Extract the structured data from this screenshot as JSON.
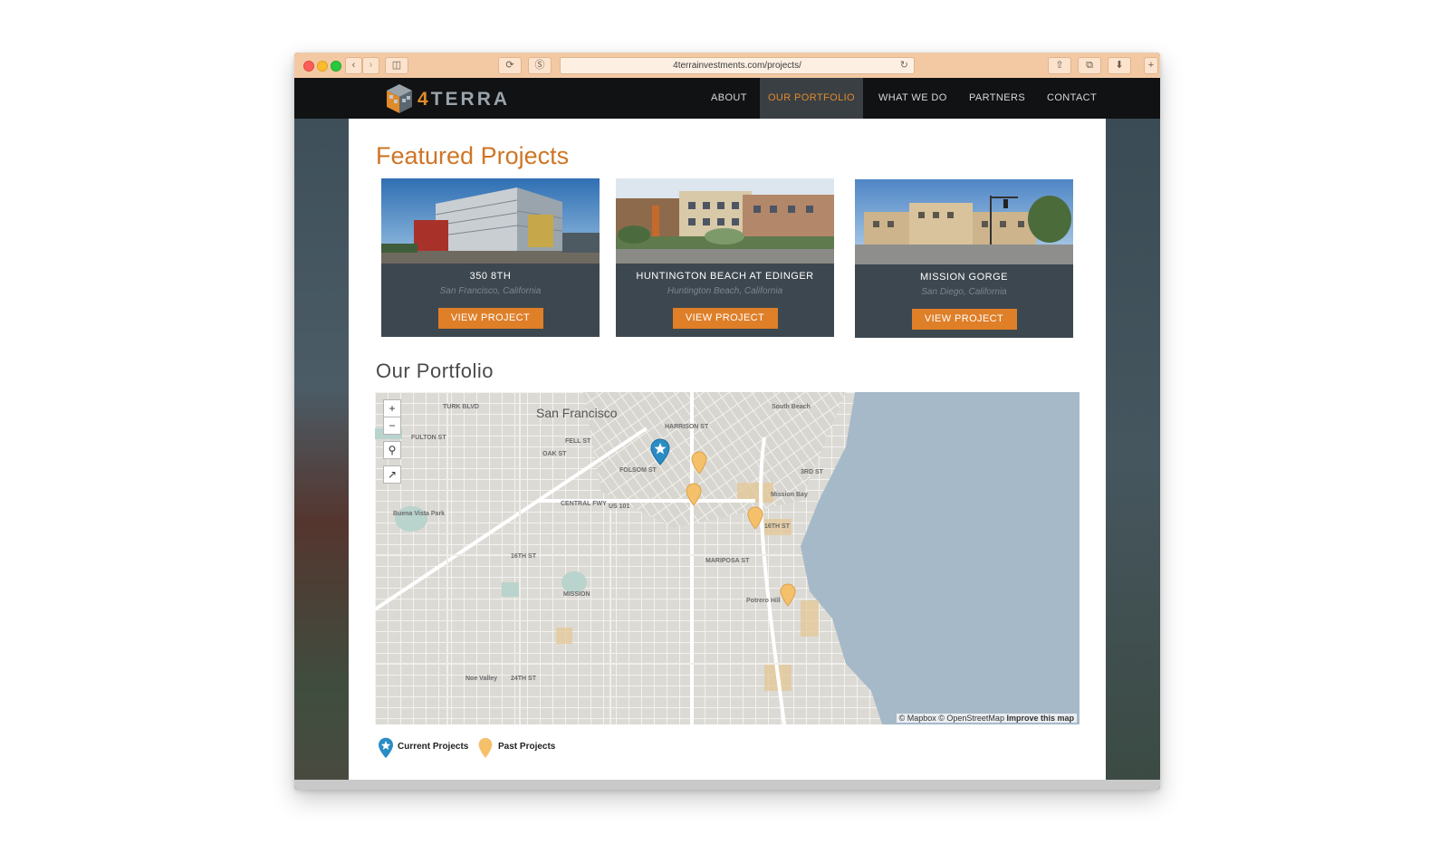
{
  "browser": {
    "url": "4terrainvestments.com/projects/"
  },
  "nav": {
    "logo_four": "4",
    "logo_terra": "TERRA",
    "items": [
      {
        "label": "ABOUT"
      },
      {
        "label": "OUR PORTFOLIO"
      },
      {
        "label": "WHAT WE DO"
      },
      {
        "label": "PARTNERS"
      },
      {
        "label": "CONTACT"
      }
    ],
    "active_color": "#e08b2b"
  },
  "featured": {
    "heading": "Featured Projects",
    "projects": [
      {
        "title": "350 8TH",
        "location": "San Francisco, California",
        "button": "VIEW PROJECT"
      },
      {
        "title": "HUNTINGTON BEACH AT EDINGER",
        "location": "Huntington Beach, California",
        "button": "VIEW PROJECT"
      },
      {
        "title": "MISSION GORGE",
        "location": "San Diego, California",
        "button": "VIEW PROJECT"
      }
    ]
  },
  "portfolio": {
    "heading": "Our Portfolio",
    "map": {
      "city_label": "San Francisco",
      "zoom_in": "+",
      "zoom_out": "−",
      "attribution_prefix": "© Mapbox © OpenStreetMap",
      "attribution_link": "Improve this map",
      "street_labels": [
        "TURK BLVD",
        "FULTON ST",
        "FELL ST",
        "OAK ST",
        "FOLSOM ST",
        "CENTRAL FWY",
        "US 101",
        "16TH ST",
        "MARIPOSA ST",
        "MISSION",
        "Mission Bay",
        "Potrero Hill",
        "Buena Vista Park",
        "Noe Valley",
        "24TH ST",
        "HARRISON ST",
        "16TH ST",
        "3RD ST",
        "South Beach"
      ]
    },
    "legend": {
      "current": "Current Projects",
      "past": "Past Projects"
    }
  },
  "colors": {
    "accent": "#df7f28",
    "heading": "#cf7526",
    "current_marker": "#2a8cc4",
    "past_marker": "#f5c06a",
    "water": "#a6b9c8"
  }
}
